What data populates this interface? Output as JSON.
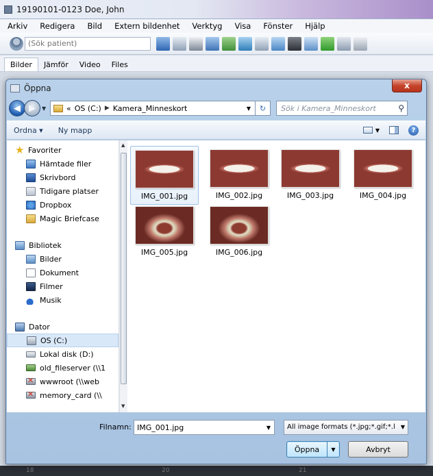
{
  "app": {
    "title": "19190101-0123 Doe, John",
    "menus": [
      "Arkiv",
      "Redigera",
      "Bild",
      "Extern bildenhet",
      "Verktyg",
      "Visa",
      "Fönster",
      "Hjälp"
    ],
    "search_placeholder": "(Sök patient)",
    "tabs": [
      "Bilder",
      "Jämför",
      "Video",
      "Files"
    ],
    "bottom_numbers": [
      "18",
      "20",
      "21"
    ]
  },
  "dialog": {
    "title": "Öppna",
    "close_glyph": "x",
    "breadcrumb": [
      "«",
      "OS (C:)",
      "Kamera_Minneskort"
    ],
    "search_placeholder": "Sök i Kamera_Minneskort",
    "commands": {
      "organize": "Ordna ▾",
      "new_folder": "Ny mapp"
    },
    "nav": {
      "favorites": {
        "label": "Favoriter",
        "items": [
          "Hämtade filer",
          "Skrivbord",
          "Tidigare platser",
          "Dropbox",
          "Magic Briefcase"
        ]
      },
      "libraries": {
        "label": "Bibliotek",
        "items": [
          "Bilder",
          "Dokument",
          "Filmer",
          "Musik"
        ]
      },
      "computer": {
        "label": "Dator",
        "items": [
          "OS (C:)",
          "Lokal disk (D:)",
          "old_fileserver (\\\\1",
          "wwwroot (\\\\web",
          "memory_card (\\\\"
        ]
      }
    },
    "files": [
      {
        "name": "IMG_001.jpg",
        "selected": true
      },
      {
        "name": "IMG_002.jpg",
        "selected": false
      },
      {
        "name": "IMG_003.jpg",
        "selected": false
      },
      {
        "name": "IMG_004.jpg",
        "selected": false
      },
      {
        "name": "IMG_005.jpg",
        "selected": false
      },
      {
        "name": "IMG_006.jpg",
        "selected": false
      }
    ],
    "filename_label": "Filnamn:",
    "filename_value": "IMG_001.jpg",
    "filetype": "All image formats (*.jpg;*.gif;*.l",
    "open_label": "Öppna",
    "cancel_label": "Avbryt"
  }
}
